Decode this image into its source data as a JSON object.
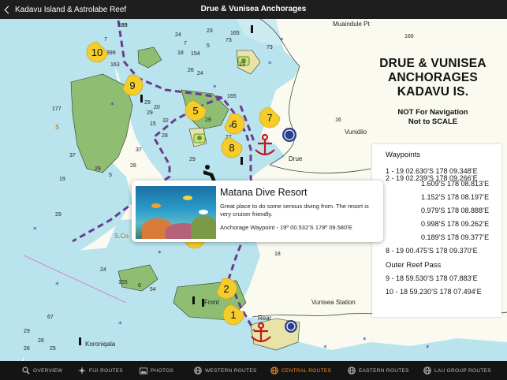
{
  "topbar": {
    "back_label": "Kadavu Island & Astrolabe Reef",
    "title": "Drue & Vunisea Anchorages"
  },
  "chart": {
    "title_lines": [
      "DRUE & VUNISEA",
      "ANCHORAGES",
      "KADAVU IS."
    ],
    "note_lines": [
      "NOT For Navigation",
      "Not to SCALE"
    ]
  },
  "map_labels": {
    "maiundule_pt": "Muaindule Pt",
    "vunidilo": "Vunidilo",
    "drue": "Drue",
    "vunisea_station": "Vunisea Station",
    "koroniqala": "Koroniqala",
    "front": "Front",
    "rear": "Rear",
    "s_left": "S",
    "sco": "S.Co"
  },
  "depths": [
    "183",
    "24",
    "23",
    "18",
    "26",
    "24",
    "7",
    "23",
    "73",
    "5",
    "73",
    "166",
    "177",
    "29",
    "20",
    "15",
    "32",
    "29",
    "37",
    "29",
    "28",
    "37",
    "28",
    "5",
    "19",
    "29",
    "27",
    "29",
    "29",
    "24",
    "155",
    "6",
    "54",
    "67",
    "29",
    "28",
    "26",
    "25",
    "18",
    "16",
    "7",
    "399",
    "154",
    "165",
    "165",
    "163",
    "155"
  ],
  "waypoint_markers": [
    {
      "num": "10"
    },
    {
      "num": "9"
    },
    {
      "num": "5"
    },
    {
      "num": "7"
    },
    {
      "num": "6"
    },
    {
      "num": "8"
    },
    {
      "num": "3"
    },
    {
      "num": "2"
    },
    {
      "num": "1"
    }
  ],
  "waypoints_panel": {
    "header": "Waypoints",
    "rows": [
      "1 - 19 02.630’S  178 09.348’E",
      "2 - 19 02.239’S  178 09.266’E",
      "3 - 19 01.609’S  178 08.813’E",
      "4 - 19 01.152’S  178 08.197’E",
      "5 - 19 00.979’S  178 08.888’E",
      "6 - 19 00.998’S  178 09.262’E",
      "7 - 19 00.189’S  178 09.377’E",
      "8 - 19 00.475’S  178 09.370’E"
    ],
    "visible_rows": [
      "1 - 19 02.630’S  178 09.348’E",
      "2 - 19 02.239’S  178 09.266’E",
      "1.609’S  178 08.813’E",
      "1.152’S  178 08.197’E",
      "0.979’S  178 08.888’E",
      "0.998’S  178 09.262’E",
      "0.189’S  178 09.377’E",
      "8 - 19 00.475’S  178 09.370’E"
    ],
    "subheader": "Outer Reef Pass",
    "outer_rows": [
      "9 - 18 59.530’S  178 07.883’E",
      "10 - 18 59.230’S  178 07.494’E"
    ]
  },
  "popup": {
    "title": "Matana Dive Resort",
    "description": "Great place to do some serious diving from. The resort is very cruiser friendly.",
    "waypoint": "Anchorage Waypoint - 19º 00.532’S   178º 09.580’E",
    "image_name": "coral-reef-photo"
  },
  "tabs": [
    {
      "label": "OVERVIEW",
      "icon": "search-icon",
      "active": false
    },
    {
      "label": "FIJI ROUTES",
      "icon": "compass-rose-icon",
      "active": false
    },
    {
      "label": "PHOTOS",
      "icon": "photo-icon",
      "active": false
    },
    {
      "label": "WESTERN ROUTES",
      "icon": "globe-icon",
      "active": false
    },
    {
      "label": "CENTRAL ROUTES",
      "icon": "globe-icon",
      "active": true
    },
    {
      "label": "EASTERN ROUTES",
      "icon": "globe-icon",
      "active": false
    },
    {
      "label": "LAU GROUP ROUTES",
      "icon": "globe-icon",
      "active": false
    }
  ],
  "colors": {
    "route": "#6b3c8e",
    "marker": "#f4cc2c",
    "shallow_water": "#b9e4ee",
    "land": "#8fbd72",
    "anchor": "#c4161c",
    "active_tab": "#ff8a1c"
  }
}
